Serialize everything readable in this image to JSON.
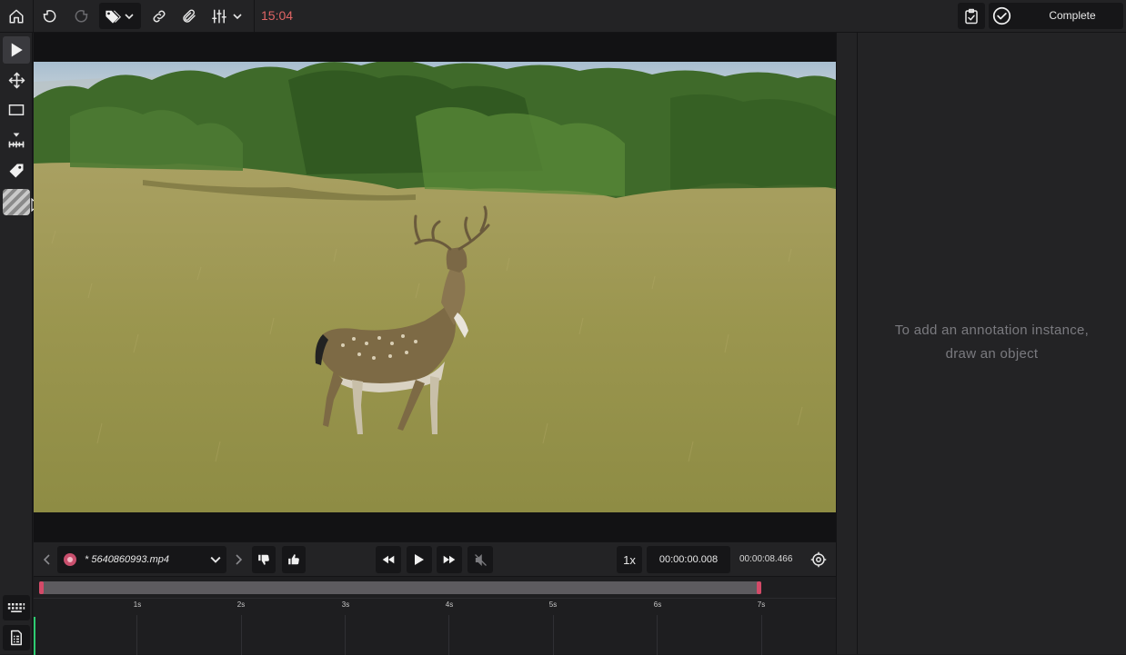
{
  "header": {
    "timer": "15:04",
    "complete_label": "Complete"
  },
  "canvas": {
    "image_alt": "Fallow deer standing in a grassy meadow with trees behind"
  },
  "annotations_panel": {
    "empty_hint_line1": "To add an annotation instance,",
    "empty_hint_line2": "draw an object"
  },
  "player": {
    "file_name": "* 5640860993.mp4",
    "speed": "1x",
    "current_time": "00:00:00.008",
    "total_time": "00:00:08.466"
  },
  "timeline": {
    "ticks": [
      "1s",
      "2s",
      "3s",
      "4s",
      "5s",
      "6s",
      "7s"
    ]
  },
  "colors": {
    "accent": "#d44a68",
    "timer": "#e06565",
    "playhead": "#2ecc71"
  }
}
